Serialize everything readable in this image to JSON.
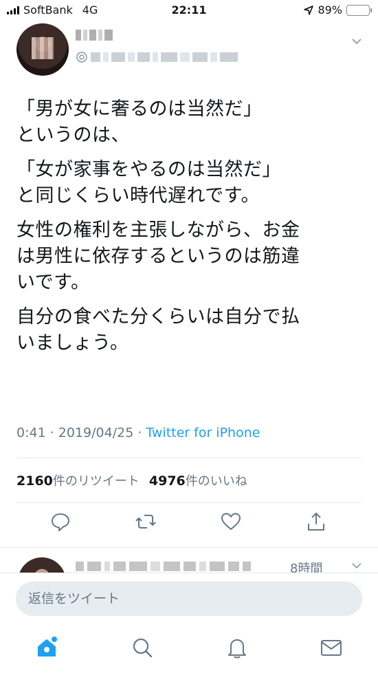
{
  "status_bar": {
    "carrier": "SoftBank",
    "network": "4G",
    "time": "22:11",
    "battery_percent": "89%",
    "battery_level": 0.89,
    "battery_color": "#f4c400",
    "location_icon": "location-arrow-icon"
  },
  "tweet": {
    "paragraphs": [
      "「男が女に奢るのは当然だ」\nというのは、",
      "「女が家事をやるのは当然だ」\nと同じくらい時代遅れです。",
      "女性の権利を主張しながら、お金\nは男性に依存するというのは筋違\nいです。",
      "自分の食べた分くらいは自分で払\nいましょう。"
    ],
    "timestamp": "0:41 · 2019/04/25 · ",
    "source": "Twitter for iPhone",
    "retweet_count": "2160",
    "retweet_label": "件のリツイート",
    "like_count": "4976",
    "like_label": "件のいいね"
  },
  "actions": {
    "reply_icon": "reply-icon",
    "retweet_icon": "retweet-icon",
    "like_icon": "heart-icon",
    "share_icon": "share-icon"
  },
  "next_tweet": {
    "time": "8時間"
  },
  "reply_box": {
    "placeholder": "返信をツイート"
  },
  "tabs": [
    "home-icon",
    "search-icon",
    "notifications-icon",
    "messages-icon"
  ],
  "colors": {
    "accent": "#1da1f2",
    "muted": "#657786",
    "divider": "#e1e8ed"
  }
}
